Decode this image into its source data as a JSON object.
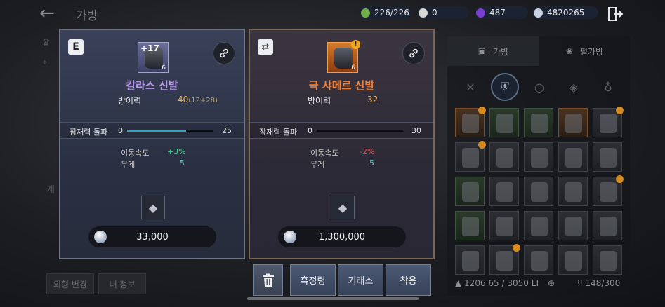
{
  "header": {
    "title": "가방",
    "currencies": [
      {
        "icon": "weight-icon",
        "value": "226/226"
      },
      {
        "icon": "pearl-icon",
        "value": "0"
      },
      {
        "icon": "purple-gem-icon",
        "value": "487"
      },
      {
        "icon": "silver-coin-icon",
        "value": "4820265"
      }
    ]
  },
  "background_panel": {
    "section_label": "계",
    "button_appearance": "외형 변경",
    "button_myinfo": "내 정보"
  },
  "inventory": {
    "tab_bag": "가방",
    "tab_pearl_bag": "펄가방",
    "weight": "1206.65 / 3050 LT",
    "slots": "148/300"
  },
  "equipped_item": {
    "badge": "E",
    "enhancement": "+17",
    "level": "6",
    "name": "칼라스 신발",
    "stat_label": "방어력",
    "stat_value": "40",
    "stat_detail": "(12+28)",
    "potential_label": "잠재력 돌파",
    "potential_min": "0",
    "potential_max": "25",
    "potential_progress": 0.68,
    "sub_stats": [
      {
        "label": "이동속도",
        "value": "+3%"
      },
      {
        "label": "무게",
        "value": "5"
      }
    ],
    "price": "33,000"
  },
  "compared_item": {
    "level": "6",
    "name": "극 샤메르 신발",
    "stat_label": "방어력",
    "stat_value": "32",
    "potential_label": "잠재력 돌파",
    "potential_min": "0",
    "potential_max": "30",
    "potential_progress": 0.0,
    "sub_stats": [
      {
        "label": "이동속도",
        "value": "-2%"
      },
      {
        "label": "무게",
        "value": "5"
      }
    ],
    "price": "1,300,000"
  },
  "actions": {
    "smelt": "흑정령",
    "market": "거래소",
    "equip": "착용"
  },
  "colors": {
    "equipped_name": "#b79ae8",
    "compared_name": "#f0813a",
    "positive": "#3fd08e",
    "negative": "#e04a4a"
  }
}
